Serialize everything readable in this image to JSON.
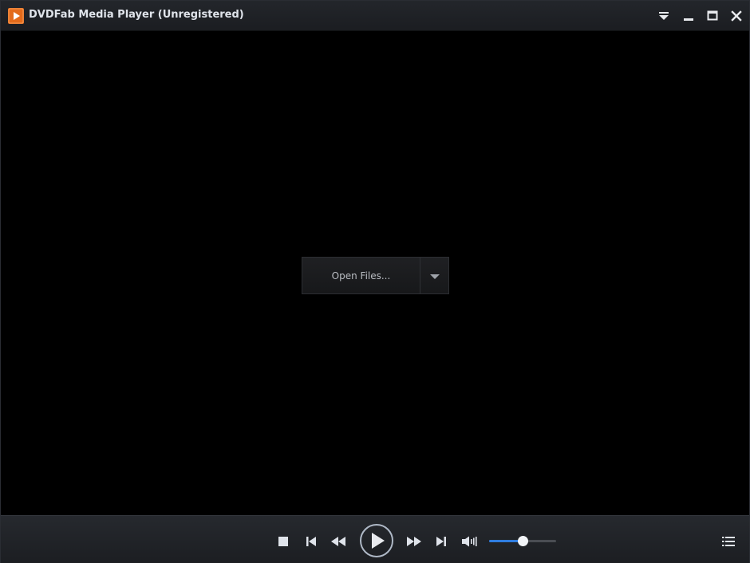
{
  "window": {
    "title": "DVDFab Media Player (Unregistered)"
  },
  "titlebar": {
    "icons": [
      "app-logo-icon",
      "dropdown-menu-icon",
      "minimize-icon",
      "maximize-icon",
      "close-icon"
    ]
  },
  "open_files": {
    "label": "Open Files...",
    "dropdown_icon": "chevron-down-icon"
  },
  "controls": {
    "icons": [
      "stop-icon",
      "previous-icon",
      "rewind-icon",
      "play-icon",
      "fast-forward-icon",
      "next-icon",
      "volume-icon",
      "playlist-icon"
    ],
    "volume_level": 0.5
  },
  "colors": {
    "accent": "#2f7de0",
    "logo": "#e36a1b"
  }
}
